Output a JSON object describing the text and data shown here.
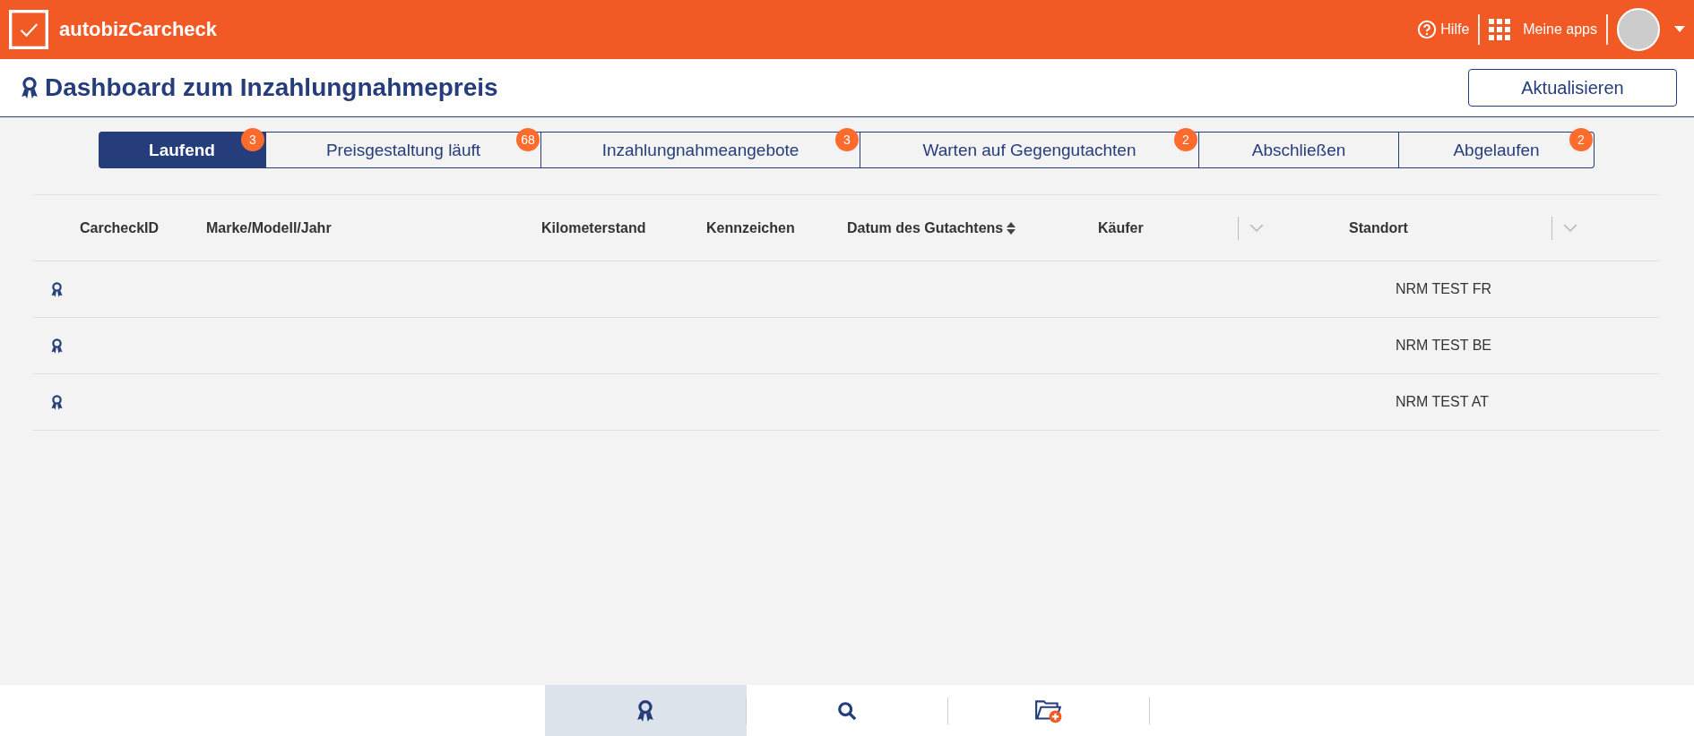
{
  "app": {
    "name": "autobizCarcheck",
    "help": "Hilfe",
    "apps": "Meine apps"
  },
  "page": {
    "title": "Dashboard zum Inzahlungnahmepreis",
    "refresh_button": "Aktualisieren"
  },
  "tabs": [
    {
      "label": "Laufend",
      "count": "3",
      "selected": true
    },
    {
      "label": "Preisgestaltung läuft",
      "count": "68",
      "selected": false
    },
    {
      "label": "Inzahlungnahmeangebote",
      "count": "3",
      "selected": false
    },
    {
      "label": "Warten auf Gegengutachten",
      "count": "2",
      "selected": false
    },
    {
      "label": "Abschließen",
      "selected": false
    },
    {
      "label": "Abgelaufen",
      "count": "2",
      "selected": false
    }
  ],
  "table": {
    "columns": [
      {
        "label": "CarcheckID",
        "kind": "plain"
      },
      {
        "label": "Marke/Modell/Jahr",
        "kind": "plain"
      },
      {
        "label": "Kilometerstand",
        "kind": "plain"
      },
      {
        "label": "Kennzeichen",
        "kind": "plain"
      },
      {
        "label": "Datum des Gutachtens",
        "kind": "sortable"
      },
      {
        "label": "Käufer",
        "kind": "filter"
      },
      {
        "label": "Standort",
        "kind": "filter"
      }
    ],
    "rows": [
      {
        "standort": "NRM TEST FR"
      },
      {
        "standort": "NRM TEST BE"
      },
      {
        "standort": "NRM TEST AT"
      }
    ]
  },
  "bottom_nav": [
    {
      "kind": "award",
      "selected": true
    },
    {
      "kind": "search",
      "selected": false
    },
    {
      "kind": "new-folder",
      "selected": false
    }
  ]
}
